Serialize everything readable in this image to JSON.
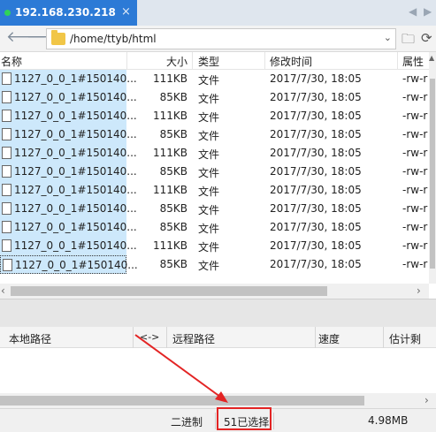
{
  "tab": {
    "title": "192.168.230.218",
    "close": "×"
  },
  "tab_nav": {
    "prev": "◀",
    "next": "▶"
  },
  "address": {
    "path": "/home/ttyb/html",
    "dropdown": "⌄"
  },
  "columns": {
    "name": "名称",
    "size": "大小",
    "type": "类型",
    "modified": "修改时间",
    "attr": "属性"
  },
  "files": [
    {
      "name": "1127_0_0_1#150140...",
      "size": "111KB",
      "type": "文件",
      "modified": "2017/7/30, 18:05",
      "attr": "-rw-r"
    },
    {
      "name": "1127_0_0_1#150140...",
      "size": "85KB",
      "type": "文件",
      "modified": "2017/7/30, 18:05",
      "attr": "-rw-r"
    },
    {
      "name": "1127_0_0_1#150140...",
      "size": "111KB",
      "type": "文件",
      "modified": "2017/7/30, 18:05",
      "attr": "-rw-r"
    },
    {
      "name": "1127_0_0_1#150140...",
      "size": "85KB",
      "type": "文件",
      "modified": "2017/7/30, 18:05",
      "attr": "-rw-r"
    },
    {
      "name": "1127_0_0_1#150140...",
      "size": "111KB",
      "type": "文件",
      "modified": "2017/7/30, 18:05",
      "attr": "-rw-r"
    },
    {
      "name": "1127_0_0_1#150140...",
      "size": "85KB",
      "type": "文件",
      "modified": "2017/7/30, 18:05",
      "attr": "-rw-r"
    },
    {
      "name": "1127_0_0_1#150140...",
      "size": "111KB",
      "type": "文件",
      "modified": "2017/7/30, 18:05",
      "attr": "-rw-r"
    },
    {
      "name": "1127_0_0_1#150140...",
      "size": "85KB",
      "type": "文件",
      "modified": "2017/7/30, 18:05",
      "attr": "-rw-r"
    },
    {
      "name": "1127_0_0_1#150140...",
      "size": "85KB",
      "type": "文件",
      "modified": "2017/7/30, 18:05",
      "attr": "-rw-r"
    },
    {
      "name": "1127_0_0_1#150140...",
      "size": "111KB",
      "type": "文件",
      "modified": "2017/7/30, 18:05",
      "attr": "-rw-r"
    },
    {
      "name": "1127_0_0_1#150140...",
      "size": "85KB",
      "type": "文件",
      "modified": "2017/7/30, 18:05",
      "attr": "-rw-r"
    }
  ],
  "queue": {
    "local_path": "本地路径",
    "direction": "<->",
    "remote_path": "远程路径",
    "speed": "速度",
    "eta": "估计剩余..."
  },
  "status": {
    "mode": "二进制",
    "selected": "51已选择",
    "total_size": "4.98MB"
  },
  "colors": {
    "tab_active": "#2c7ad6",
    "selection": "#cde8fb",
    "annotation": "#e32424"
  },
  "icons": [
    "back-arrow-icon",
    "forward-arrow-icon",
    "folder-icon",
    "new-folder-icon",
    "refresh-icon",
    "file-icon",
    "close-icon"
  ]
}
